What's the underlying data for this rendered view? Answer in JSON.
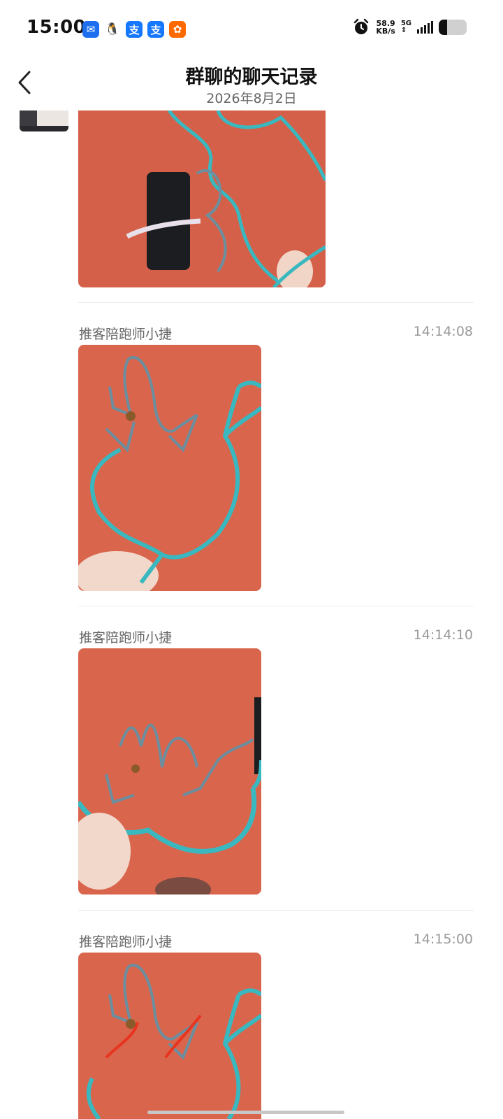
{
  "status_bar": {
    "time": "15:00",
    "apps": [
      {
        "icon": "message-app-icon",
        "glyph": "✉",
        "color": "#1e6ff0"
      },
      {
        "icon": "qq-app-icon",
        "glyph": "🐧",
        "color": "#ffffff"
      },
      {
        "icon": "alipay-app-icon",
        "glyph": "支",
        "color": "#1677ff"
      },
      {
        "icon": "alipay-app-icon",
        "glyph": "支",
        "color": "#1677ff"
      },
      {
        "icon": "taobao-app-icon",
        "glyph": "✿",
        "color": "#ff6a00"
      }
    ],
    "speed_value": "58.9",
    "speed_unit": "KB/s",
    "network": "5G",
    "battery_level": 0.3
  },
  "header": {
    "title": "群聊的聊天记录",
    "date": "2026年8月2日"
  },
  "messages": [
    {
      "sender": "推客陪跑师小捷",
      "time": "14:14:08"
    },
    {
      "sender": "推客陪跑师小捷",
      "time": "14:14:10"
    },
    {
      "sender": "推客陪跑师小捷",
      "time": "14:15:00"
    }
  ],
  "colors": {
    "photo_background": "#d9654d",
    "wire": "#3ab8bf",
    "accent": "#1677ff"
  }
}
